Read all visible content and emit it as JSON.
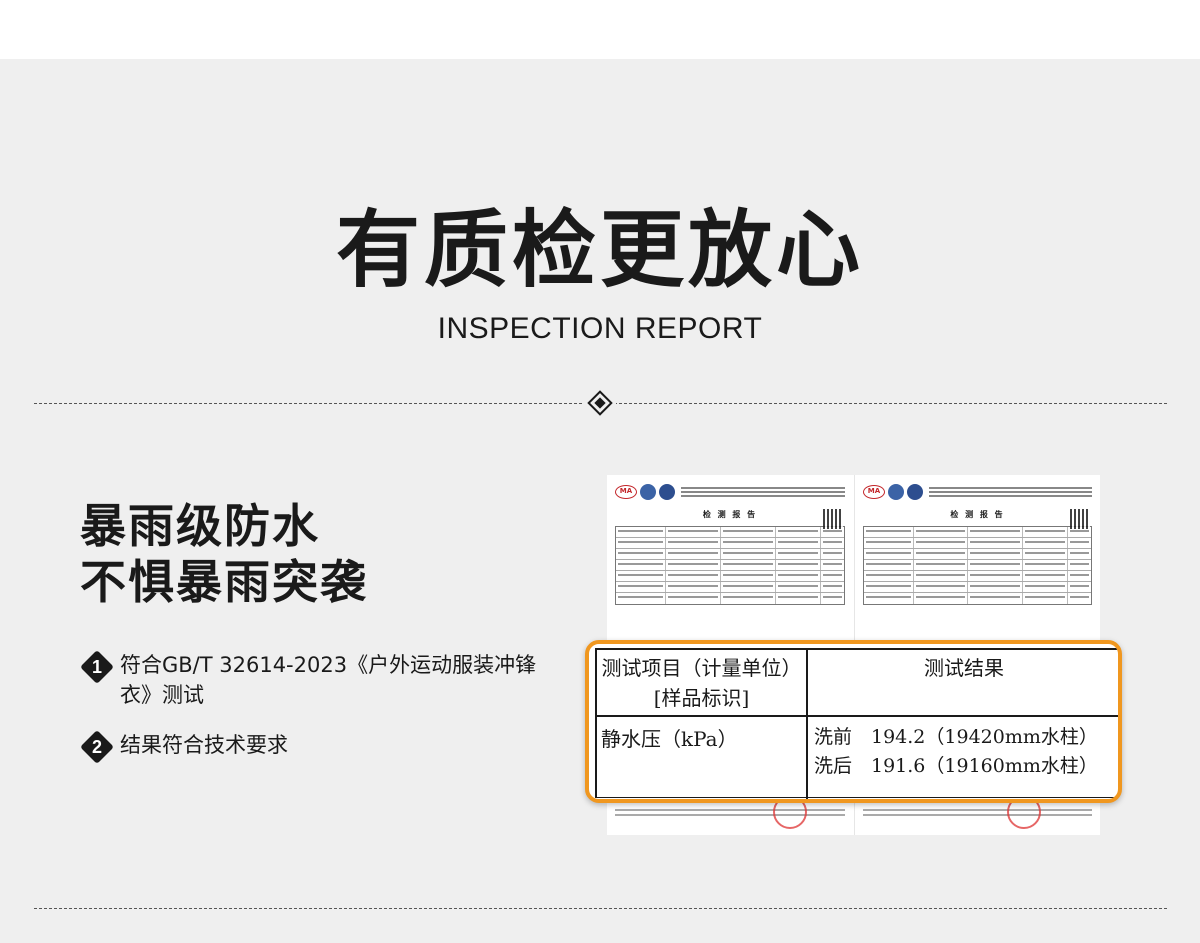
{
  "header": {
    "title_cn": "有质检更放心",
    "title_en": "INSPECTION REPORT"
  },
  "feature": {
    "title_lines": [
      "暴雨级防水",
      "不惧暴雨突袭"
    ],
    "bullets": [
      {
        "num": "1",
        "text": "符合GB/T 32614-2023《户外运动服装冲锋衣》测试"
      },
      {
        "num": "2",
        "text": "结果符合技术要求"
      }
    ]
  },
  "report": {
    "doc_title": "检 测 报 告",
    "logo_mark": "MA",
    "callout": {
      "header_item_line1": "测试项目（计量单位）",
      "header_item_line2": "[样品标识]",
      "header_result": "测试结果",
      "item": "静水压（kPa）",
      "before": "洗前　194.2（19420mm水柱）",
      "after": "洗后　191.6（19160mm水柱）"
    }
  },
  "colors": {
    "background": "#efefef",
    "text": "#1a1a1a",
    "callout_border": "#f0971f"
  }
}
